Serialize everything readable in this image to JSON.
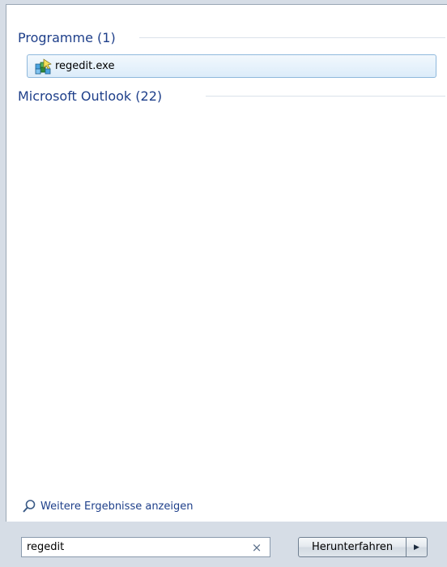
{
  "groups": [
    {
      "title": "Programme (1)"
    },
    {
      "title": "Microsoft Outlook (22)"
    }
  ],
  "results": [
    {
      "label": "regedit.exe",
      "icon": "registry-editor-icon"
    }
  ],
  "more_results": {
    "label": "Weitere Ergebnisse anzeigen",
    "icon": "magnifier-icon"
  },
  "search": {
    "value": "regedit",
    "clear_icon": "clear-x-icon",
    "clear_glyph": "×"
  },
  "shutdown": {
    "label": "Herunterfahren",
    "arrow_glyph": "▶"
  },
  "colors": {
    "header_text": "#1e3f8a",
    "selection_border": "#8fb8dc",
    "panel_background": "#ffffff",
    "frame_background": "#d6dde6"
  }
}
